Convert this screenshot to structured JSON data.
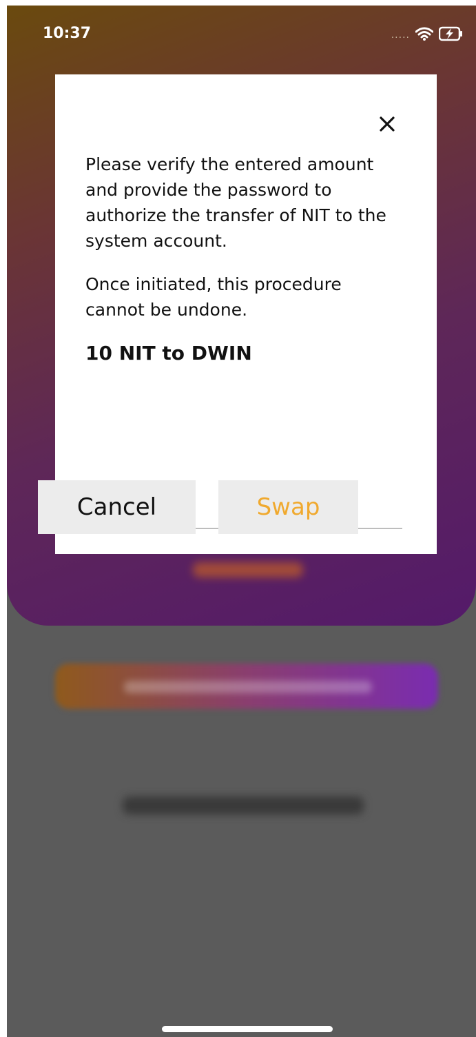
{
  "status_bar": {
    "time": "10:37",
    "signal": "....."
  },
  "modal": {
    "paragraph1": "Please verify the entered amount and provide the password to authorize the transfer of NIT to the system account.",
    "paragraph2": "Once initiated, this procedure cannot be undone.",
    "amount": "10 NIT to DWIN",
    "cancel_label": "Cancel",
    "swap_label": "Swap"
  },
  "icons": {
    "close": "close-icon",
    "wifi": "wifi-icon",
    "battery": "battery-charging-icon"
  },
  "colors": {
    "swap_text": "#f0a92e",
    "overlay": "#5b5b5b"
  }
}
